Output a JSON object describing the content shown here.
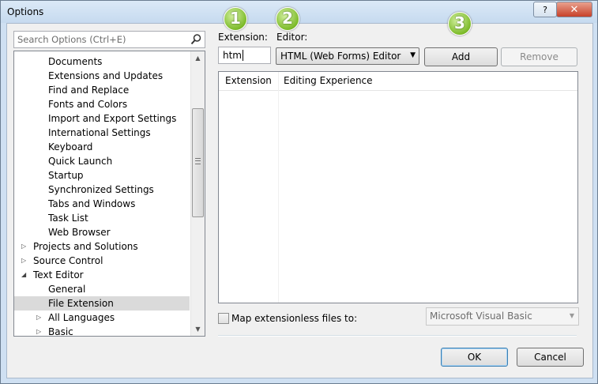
{
  "window": {
    "title": "Options",
    "help_label": "?",
    "close_label": "✕"
  },
  "search": {
    "placeholder": "Search Options (Ctrl+E)"
  },
  "tree": {
    "items": [
      {
        "label": "Documents",
        "expander": ""
      },
      {
        "label": "Extensions and Updates",
        "expander": ""
      },
      {
        "label": "Find and Replace",
        "expander": ""
      },
      {
        "label": "Fonts and Colors",
        "expander": ""
      },
      {
        "label": "Import and Export Settings",
        "expander": ""
      },
      {
        "label": "International Settings",
        "expander": ""
      },
      {
        "label": "Keyboard",
        "expander": ""
      },
      {
        "label": "Quick Launch",
        "expander": ""
      },
      {
        "label": "Startup",
        "expander": ""
      },
      {
        "label": "Synchronized Settings",
        "expander": ""
      },
      {
        "label": "Tabs and Windows",
        "expander": ""
      },
      {
        "label": "Task List",
        "expander": ""
      },
      {
        "label": "Web Browser",
        "expander": ""
      },
      {
        "label": "Projects and Solutions",
        "expander": "▷"
      },
      {
        "label": "Source Control",
        "expander": "▷"
      },
      {
        "label": "Text Editor",
        "expander": "◢"
      },
      {
        "label": "General",
        "expander": ""
      },
      {
        "label": "File Extension",
        "expander": "",
        "selected": true
      },
      {
        "label": "All Languages",
        "expander": "▷"
      },
      {
        "label": "Basic",
        "expander": "▷"
      }
    ]
  },
  "scroll": {
    "up_arrow": "▲",
    "down_arrow": "▼"
  },
  "badges": {
    "one": "1",
    "two": "2",
    "three": "3"
  },
  "extension": {
    "label": "Extension:",
    "value": "htm"
  },
  "editor": {
    "label": "Editor:",
    "value": "HTML (Web Forms) Editor",
    "arrow": "▼"
  },
  "buttons": {
    "add": "Add",
    "remove": "Remove",
    "ok": "OK",
    "cancel": "Cancel"
  },
  "grid": {
    "col_extension": "Extension",
    "col_editing": "Editing Experience"
  },
  "map": {
    "label": "Map extensionless files to:",
    "value": "Microsoft Visual Basic",
    "arrow": "▼"
  },
  "colors": {
    "badge_green": "#7dbb2a",
    "selection": "#dadada",
    "default_button_border": "#3c7fb1"
  }
}
